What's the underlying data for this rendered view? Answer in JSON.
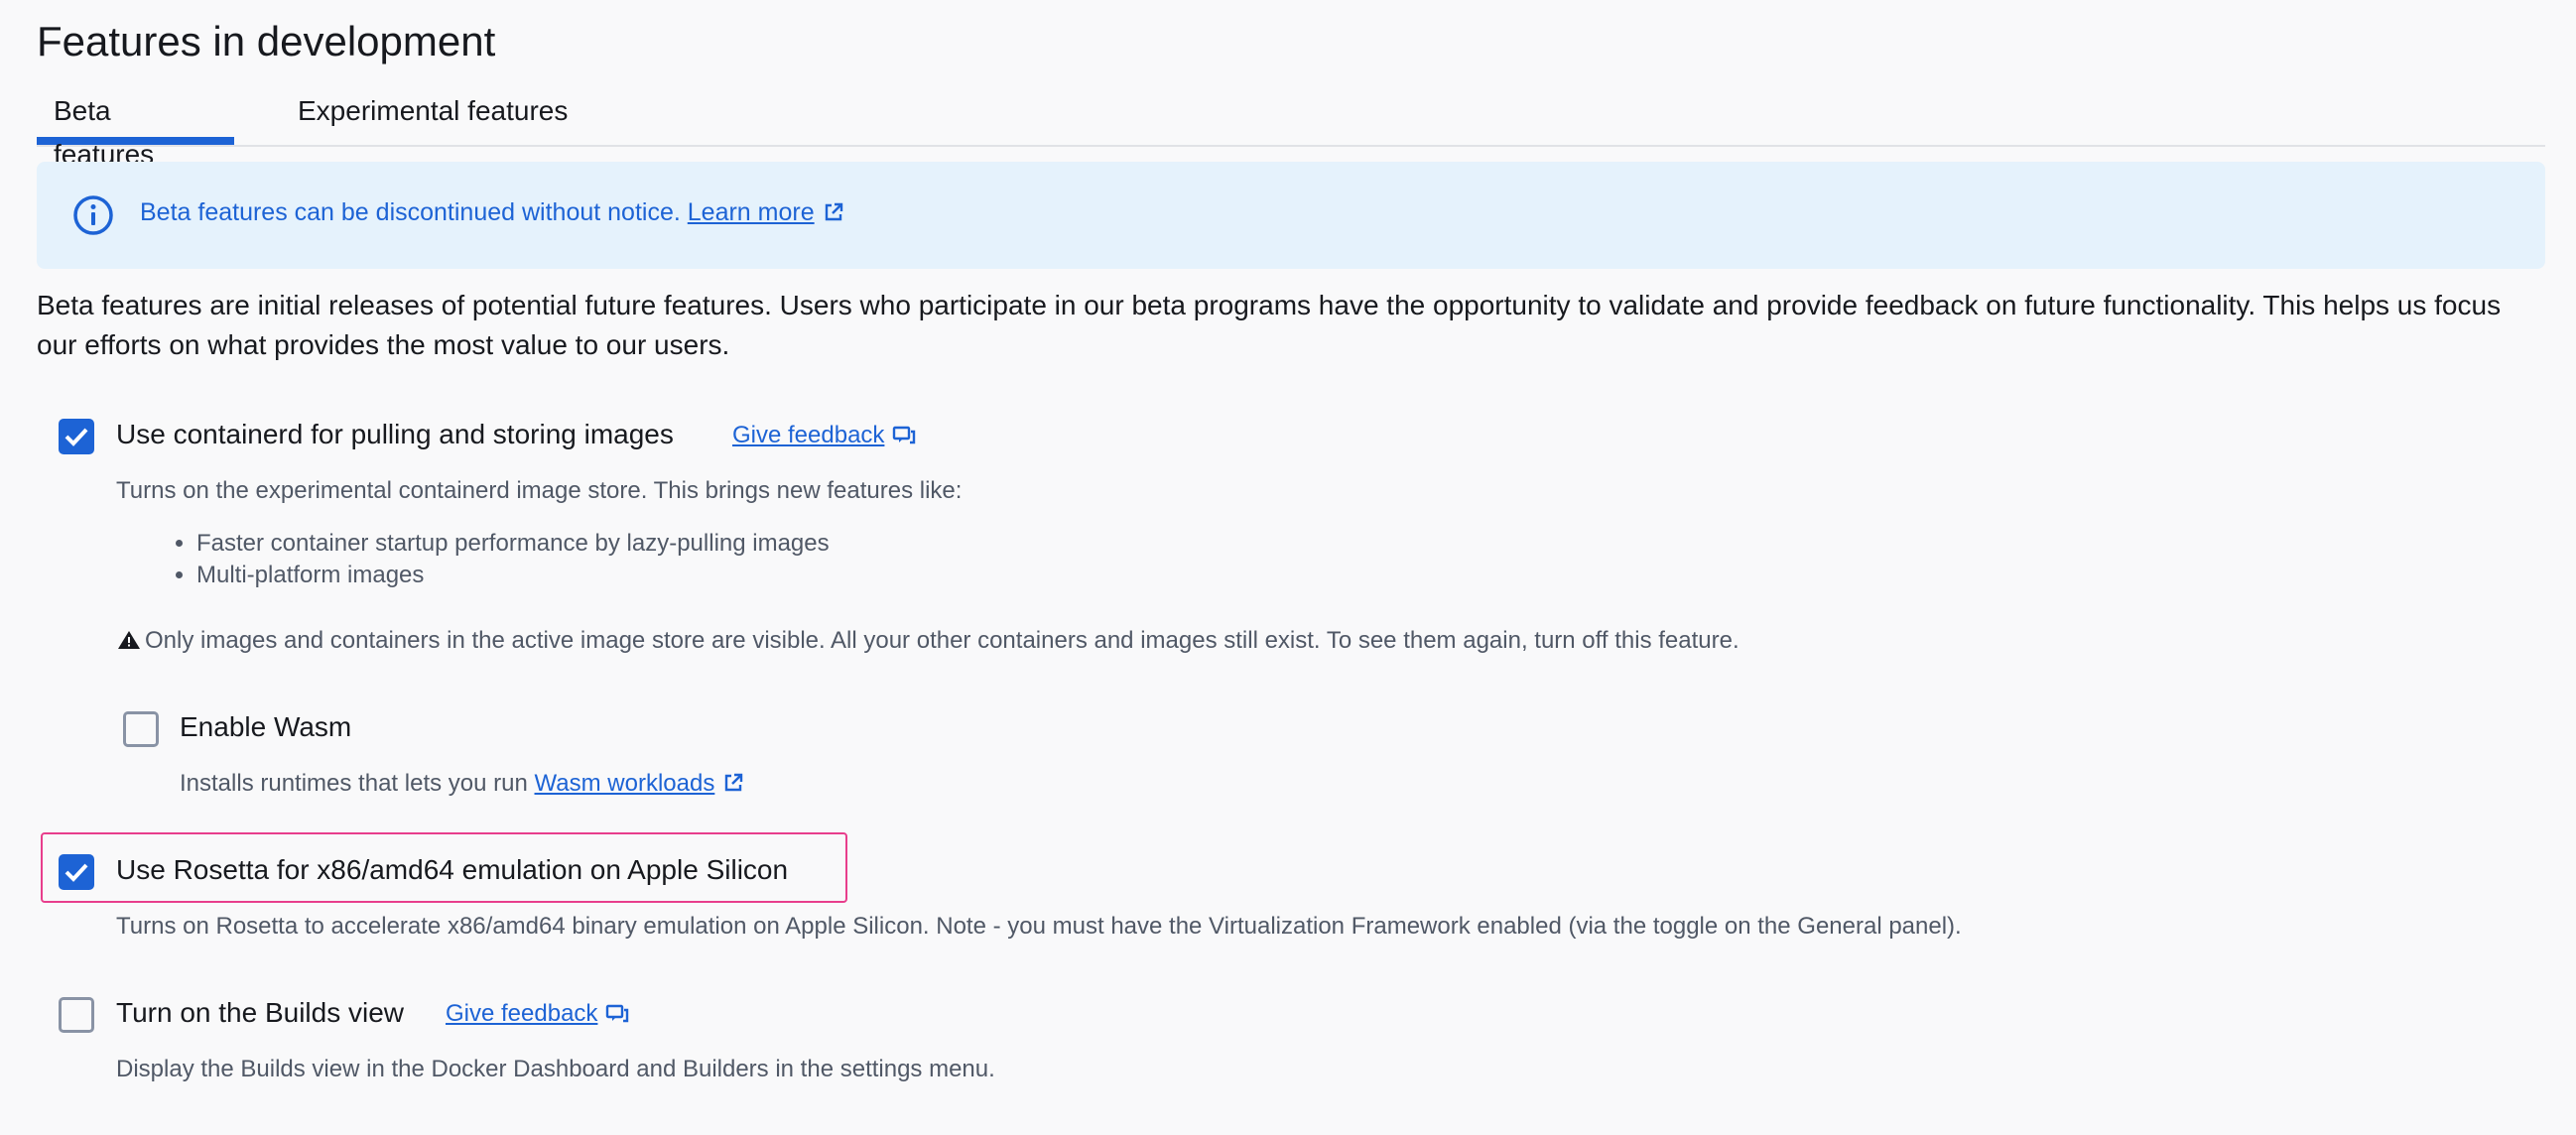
{
  "page": {
    "title": "Features in development"
  },
  "tabs": [
    {
      "label": "Beta features",
      "selected": true
    },
    {
      "label": "Experimental features",
      "selected": false
    }
  ],
  "banner": {
    "text": "Beta features can be discontinued without notice.",
    "link": "Learn more",
    "icon": "info-icon"
  },
  "description": "Beta features are initial releases of potential future features. Users who participate in our beta programs have the opportunity to validate and provide feedback on future functionality. This helps us focus our efforts on what provides the most value to our users.",
  "features": {
    "containerd": {
      "label": "Use containerd for pulling and storing images",
      "checked": true,
      "feedback": "Give feedback",
      "help": "Turns on the experimental containerd image store. This brings new features like:",
      "list": [
        "Faster container startup performance by lazy-pulling images",
        "Multi-platform images"
      ],
      "warning": "Only images and containers in the active image store are visible. All your other containers and images still exist. To see them again, turn off this feature."
    },
    "wasm": {
      "label": "Enable Wasm",
      "checked": false,
      "help_prefix": "Installs runtimes that lets you run",
      "help_link": "Wasm workloads"
    },
    "rosetta": {
      "label": "Use Rosetta for x86/amd64 emulation on Apple Silicon",
      "checked": true,
      "help": "Turns on Rosetta to accelerate x86/amd64 binary emulation on Apple Silicon. Note - you must have the Virtualization Framework enabled (via the toggle on the General panel)."
    },
    "builds": {
      "label": "Turn on the Builds view",
      "checked": false,
      "feedback": "Give feedback",
      "help": "Display the Builds view in the Docker Dashboard and Builders in the settings menu."
    }
  },
  "colors": {
    "accent": "#1d63d5",
    "banner_bg": "#e5f2fc",
    "highlight": "#e83e8c"
  }
}
